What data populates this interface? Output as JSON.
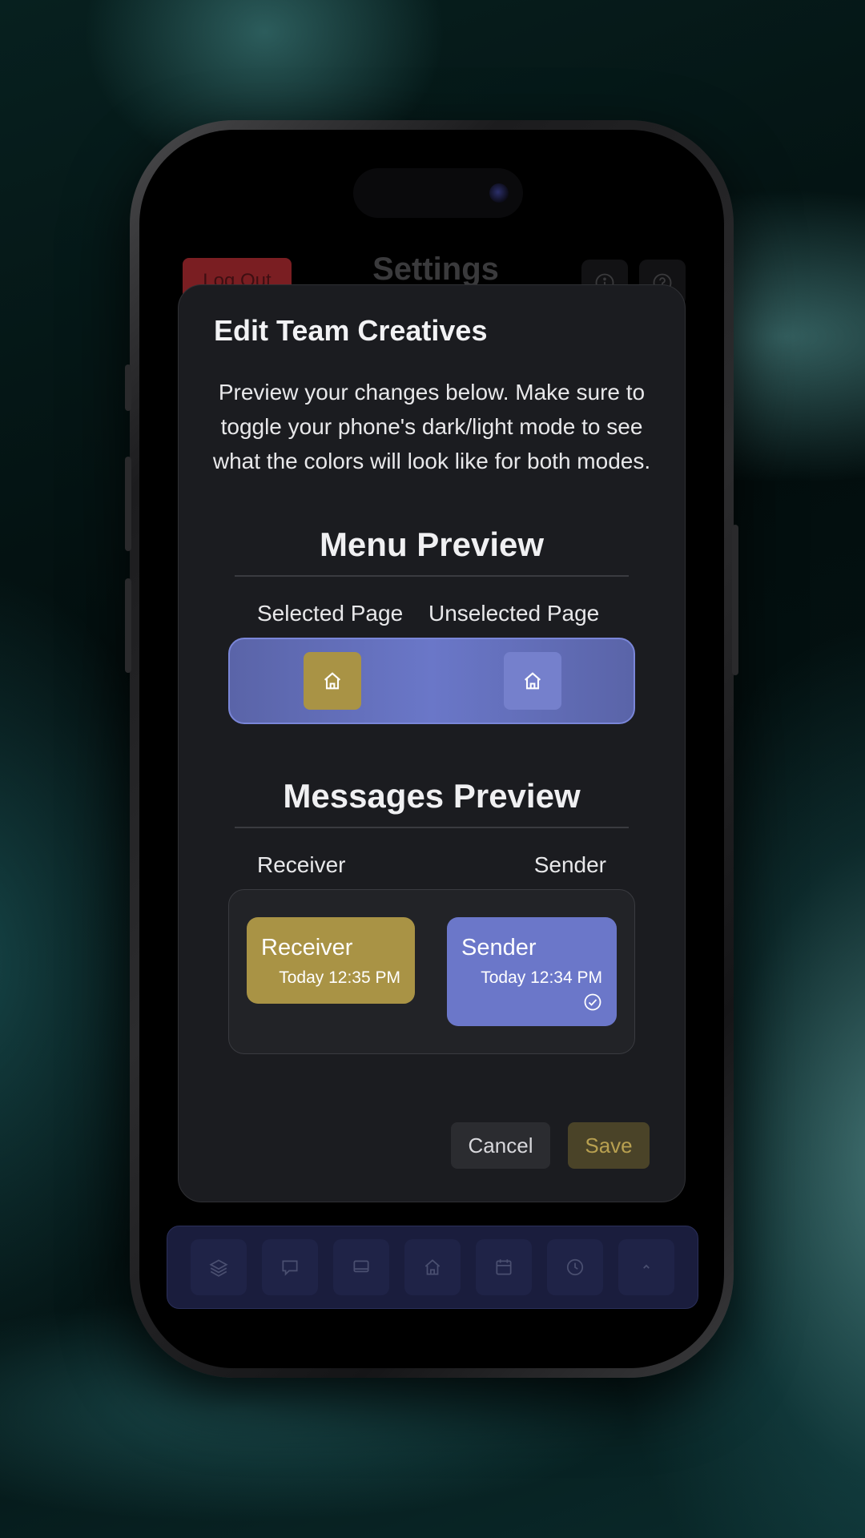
{
  "background_header": {
    "logout_label": "Log Out",
    "title": "Settings",
    "info_icon": "info-icon",
    "help_icon": "help-icon"
  },
  "modal": {
    "title": "Edit Team Creatives",
    "description": "Preview your changes below. Make sure to toggle your phone's dark/light mode to see what the colors will look like for both modes.",
    "menu_preview": {
      "title": "Menu Preview",
      "selected_label": "Selected Page",
      "unselected_label": "Unselected Page",
      "selected_icon": "home-icon",
      "unselected_icon": "home-icon"
    },
    "messages_preview": {
      "title": "Messages Preview",
      "receiver_label": "Receiver",
      "sender_label": "Sender",
      "receiver_bubble": {
        "name": "Receiver",
        "time": "Today 12:35 PM"
      },
      "sender_bubble": {
        "name": "Sender",
        "time": "Today 12:34 PM",
        "status_icon": "check-circle-icon"
      }
    },
    "cancel_label": "Cancel",
    "save_label": "Save"
  },
  "tab_bar": {
    "items": [
      {
        "icon": "layers-icon"
      },
      {
        "icon": "chat-bubble-icon"
      },
      {
        "icon": "monitor-icon"
      },
      {
        "icon": "home-icon"
      },
      {
        "icon": "calendar-icon"
      },
      {
        "icon": "clock-icon"
      },
      {
        "icon": "chevron-up-icon"
      }
    ]
  },
  "colors": {
    "primary": "#6b77c9",
    "secondary": "#a99345",
    "save_text": "#b8a050",
    "logout_bg": "#7a1e22"
  }
}
